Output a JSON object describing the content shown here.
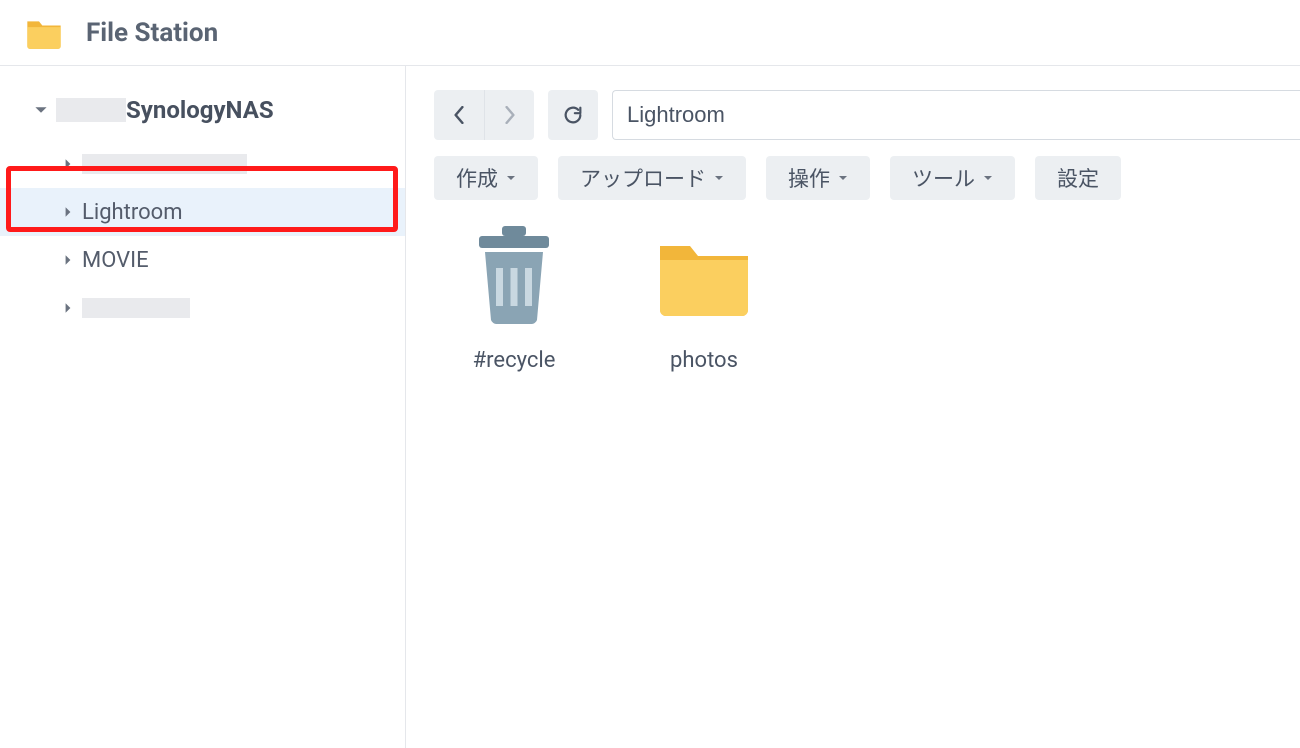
{
  "app": {
    "title": "File Station"
  },
  "sidebar": {
    "root_label": "SynologyNAS",
    "items": [
      {
        "label": "",
        "redacted": true,
        "redact_w": 165
      },
      {
        "label": "Lightroom",
        "redacted": false,
        "selected": true
      },
      {
        "label": "MOVIE",
        "redacted": false
      },
      {
        "label": "",
        "redacted": true,
        "redact_w": 108
      }
    ],
    "highlight_index": 1
  },
  "toolbar": {
    "path_value": "Lightroom",
    "buttons": {
      "create": "作成",
      "upload": "アップロード",
      "action": "操作",
      "tool": "ツール",
      "settings": "設定"
    }
  },
  "files": [
    {
      "name": "#recycle",
      "icon": "recycle"
    },
    {
      "name": "photos",
      "icon": "folder"
    }
  ]
}
